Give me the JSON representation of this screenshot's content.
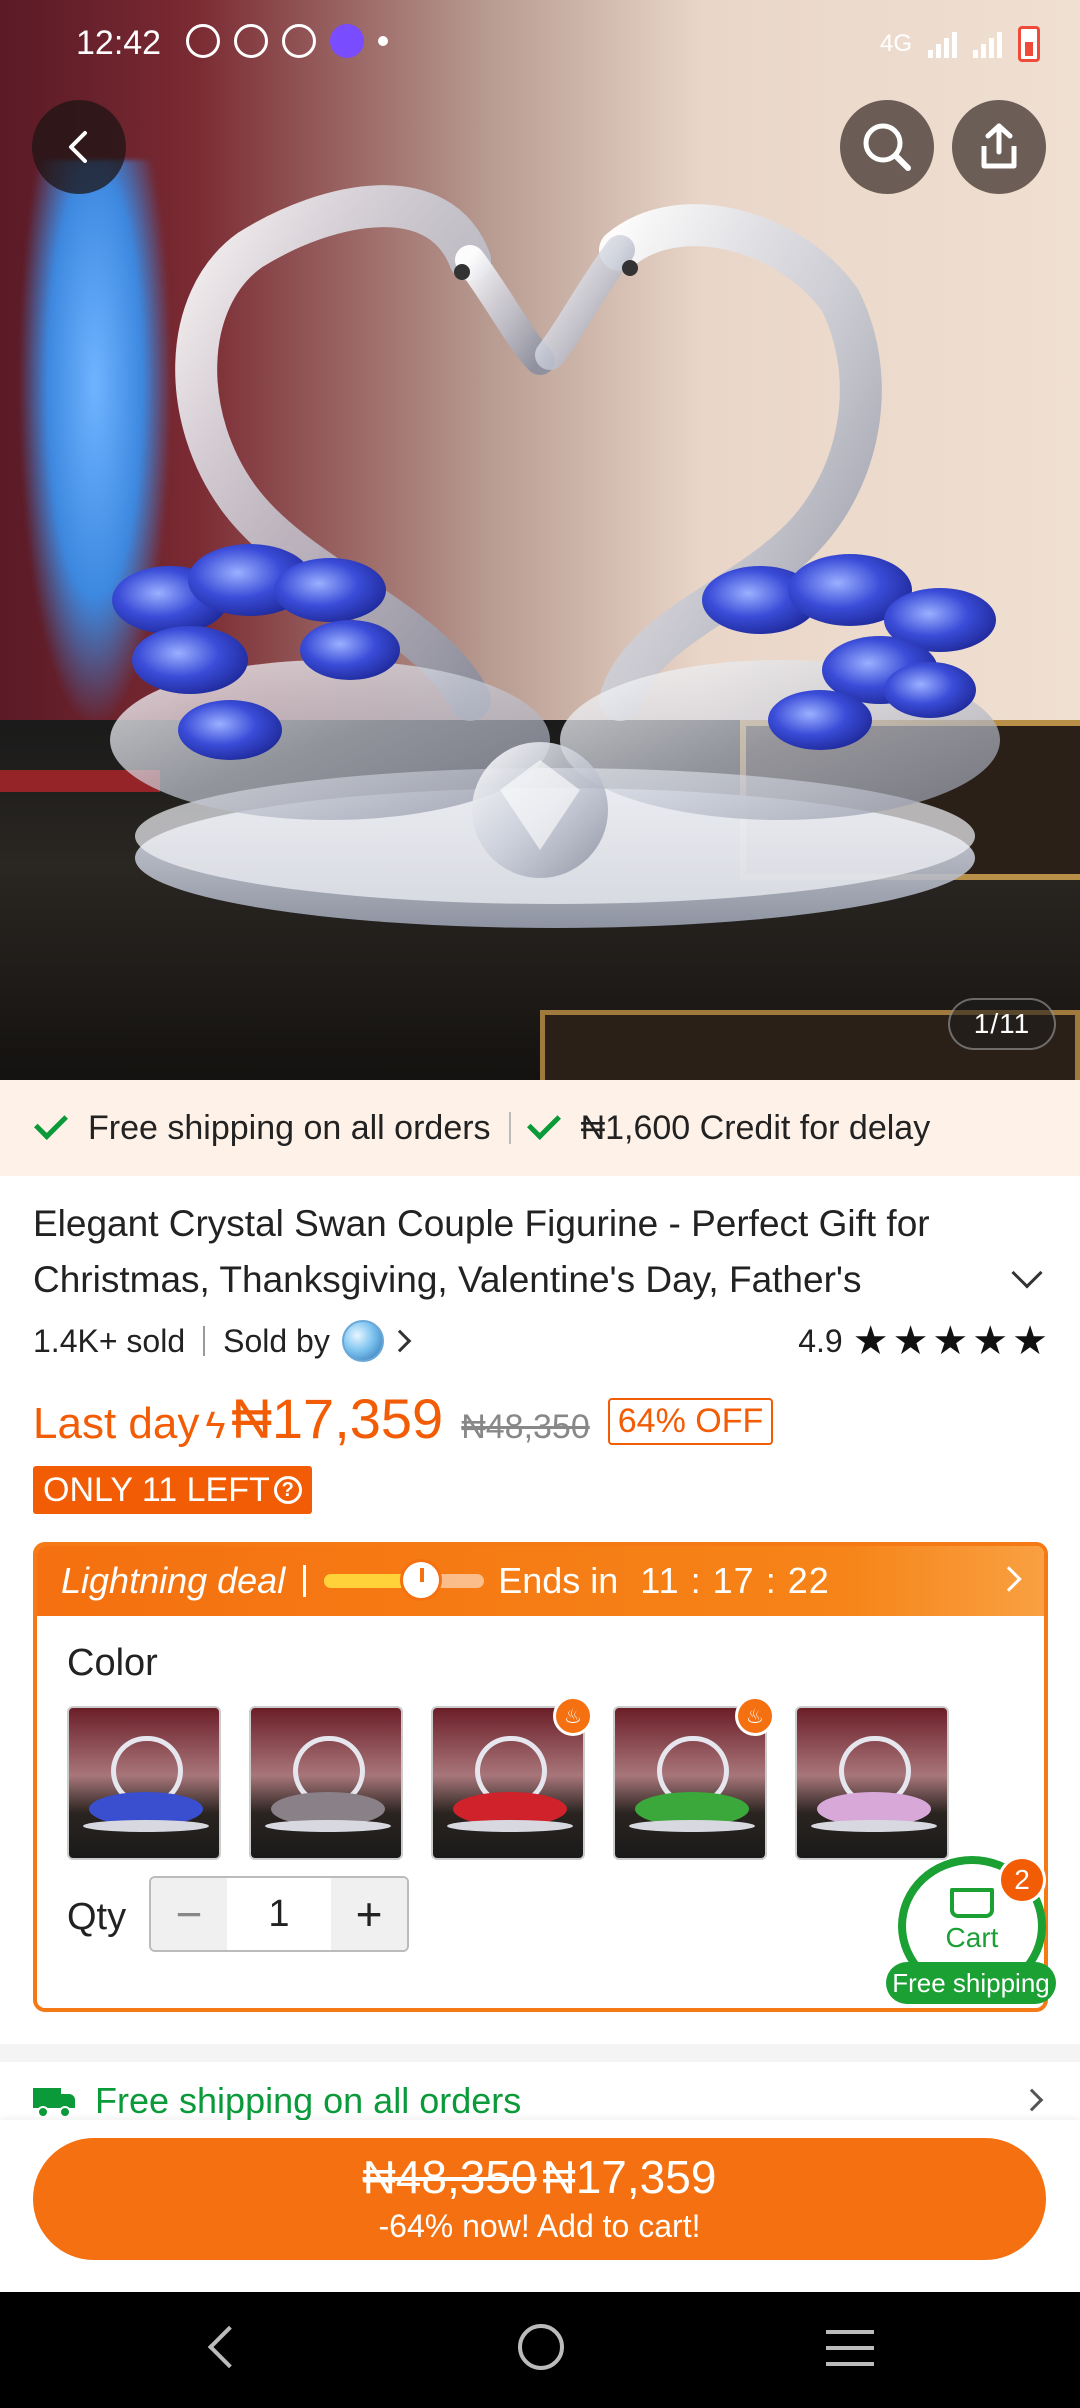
{
  "status_bar": {
    "time": "12:42",
    "network": "4G",
    "app_icons": [
      "whatsapp-icon",
      "whatsapp-business-icon",
      "chrome-icon",
      "app-icon"
    ],
    "battery_color": "#f04a3a"
  },
  "hero": {
    "image_counter": "1/11",
    "back_icon": "chevron-left-icon",
    "search_icon": "search-icon",
    "share_icon": "share-icon"
  },
  "shipping_banner": {
    "item1": "Free shipping on all orders",
    "item2": "₦1,600 Credit for delay",
    "check_color": "#0a9a3a"
  },
  "product": {
    "title": "Elegant Crystal Swan Couple Figurine - Perfect Gift for Christmas, Thanksgiving, Valentine's Day, Father's",
    "sold": "1.4K+ sold",
    "sold_by": "Sold by",
    "rating": "4.9",
    "stars": 5
  },
  "price": {
    "last_day": "Last day",
    "sale": "₦17,359",
    "original": "₦48,350",
    "discount": "64% OFF",
    "stock": "ONLY 11 LEFT",
    "accent": "#f25c05"
  },
  "deal": {
    "label": "Lightning deal",
    "ends_in": "Ends in",
    "timer": "11 : 17 : 22",
    "progress": 0.6,
    "color_label": "Color",
    "swatches": [
      {
        "name": "blue",
        "color": "#3a4fd0",
        "hot": false
      },
      {
        "name": "grey",
        "color": "#8a8088",
        "hot": false
      },
      {
        "name": "red",
        "color": "#d0222a",
        "hot": true
      },
      {
        "name": "green",
        "color": "#3aa83a",
        "hot": true
      },
      {
        "name": "pink",
        "color": "#d8a8d8",
        "hot": false
      }
    ],
    "qty_label": "Qty",
    "qty_value": "1",
    "minus": "−",
    "plus": "+"
  },
  "cart": {
    "label": "Cart",
    "badge": "2",
    "shipping": "Free shipping"
  },
  "free_shipping_row": {
    "text": "Free shipping on all orders"
  },
  "add_to_cart": {
    "old_price": "₦48,350",
    "new_price": "₦17,359",
    "subtitle": "-64% now! Add to cart!"
  }
}
